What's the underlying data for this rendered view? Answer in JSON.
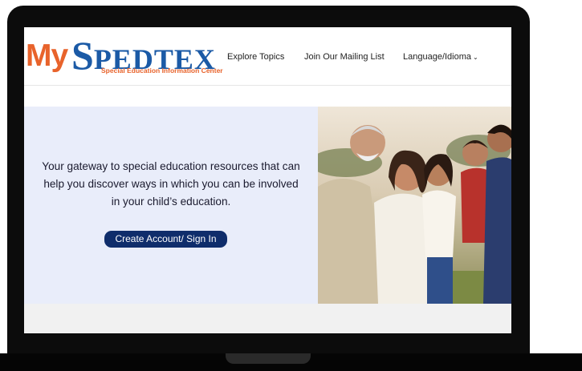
{
  "logo": {
    "my": "My",
    "spedtex_first": "S",
    "spedtex_rest": "PEDTEX",
    "tagline": "Special Education Information Center"
  },
  "nav": {
    "explore": "Explore Topics",
    "mailing": "Join Our Mailing List",
    "language": "Language/Idioma",
    "language_icon": "chevron-down-icon"
  },
  "hero": {
    "text": "Your gateway to special education resources that can help you discover ways in which you can be involved in your child’s education.",
    "cta": "Create Account/ Sign In",
    "photo_alt": "family photo"
  },
  "colors": {
    "brand_orange": "#e8632b",
    "brand_blue": "#1b5aa6",
    "hero_bg": "#e9edfa",
    "cta_bg": "#0f2d6b"
  }
}
